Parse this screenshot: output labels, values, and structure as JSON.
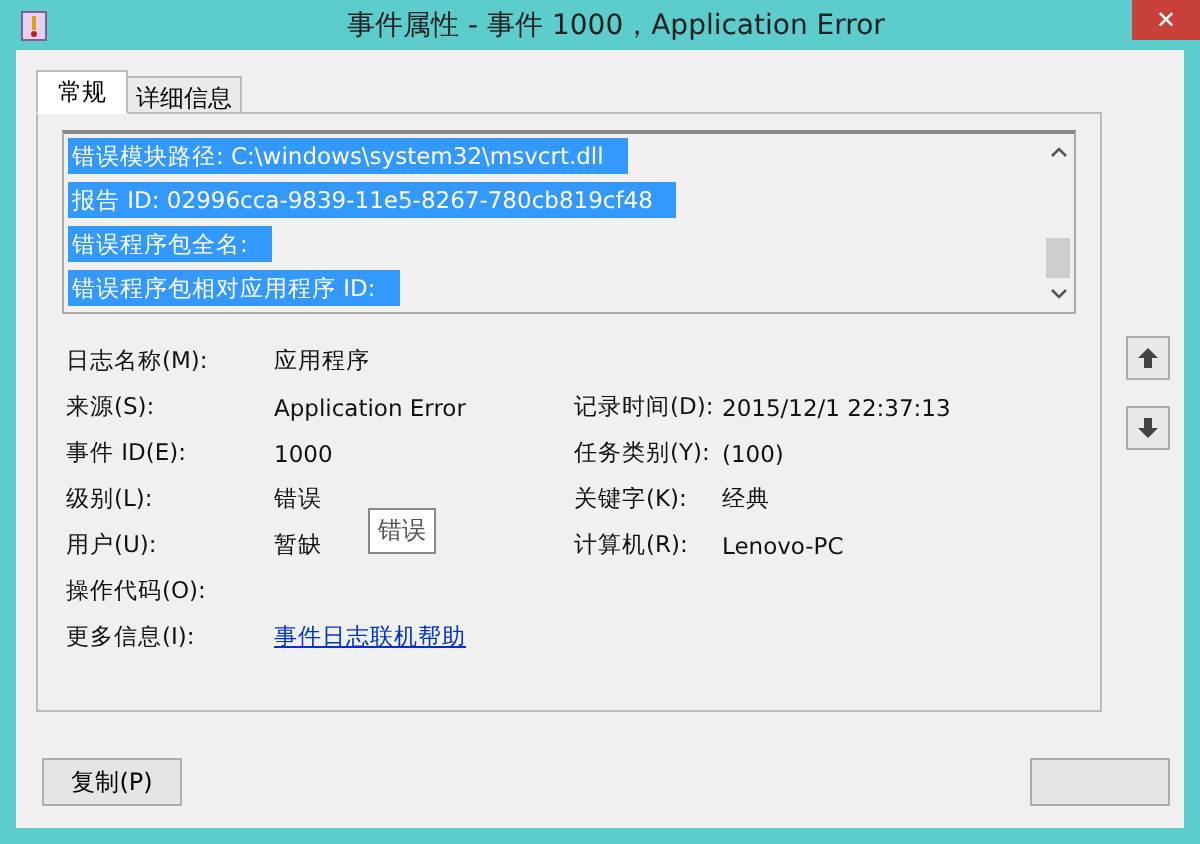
{
  "window": {
    "title": "事件属性 - 事件 1000，Application Error",
    "close": "✕"
  },
  "tabs": [
    {
      "label": "常规",
      "selected": true
    },
    {
      "label": "详细信息",
      "selected": false
    }
  ],
  "description": {
    "lines": [
      {
        "text": "错误模块路径: C:\\windows\\system32\\msvcrt.dll",
        "selected": true
      },
      {
        "text": "报告 ID: 02996cca-9839-11e5-8267-780cb819cf48",
        "selected": true
      },
      {
        "text": "错误程序包全名:",
        "selected": true
      },
      {
        "text": "错误程序包相对应用程序 ID:",
        "selected": true
      }
    ]
  },
  "fields": [
    {
      "label": "日志名称(M):",
      "value": "应用程序"
    },
    {
      "label": "来源(S):",
      "value": "Application Error",
      "label2": "记录时间(D):",
      "value2": "2015/12/1 22:37:13"
    },
    {
      "label": "事件 ID(E):",
      "value": "1000",
      "label2": "任务类别(Y):",
      "value2": "(100)"
    },
    {
      "label": "级别(L):",
      "value": "错误",
      "label2": "关键字(K):",
      "value2": "经典"
    },
    {
      "label": "用户(U):",
      "value": "暂缺",
      "label2": "计算机(R):",
      "value2": "Lenovo-PC"
    },
    {
      "label": "操作代码(O):"
    },
    {
      "label": "更多信息(I):",
      "link": "事件日志联机帮助"
    }
  ],
  "tooltip": "错误",
  "buttons": [
    {
      "label": "复制(P)"
    }
  ]
}
